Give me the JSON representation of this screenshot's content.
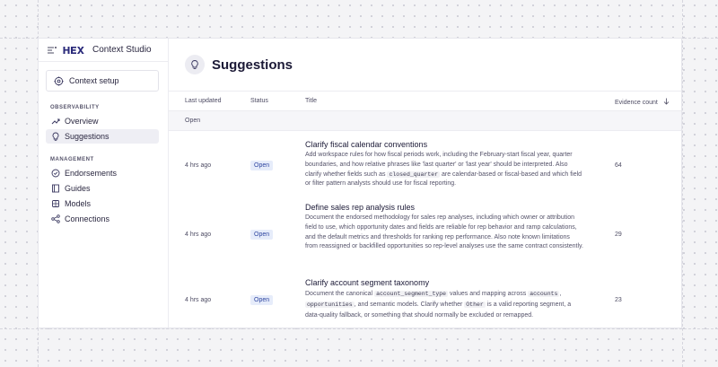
{
  "app": {
    "title": "Context Studio",
    "logo_text": "HEX"
  },
  "sidebar": {
    "context_setup_label": "Context setup",
    "observability_label": "OBSERVABILITY",
    "observability_items": [
      {
        "label": "Overview",
        "icon": "trend-icon"
      },
      {
        "label": "Suggestions",
        "icon": "lightbulb-icon",
        "active": true
      }
    ],
    "management_label": "MANAGEMENT",
    "management_items": [
      {
        "label": "Endorsements",
        "icon": "check-circle-icon"
      },
      {
        "label": "Guides",
        "icon": "book-icon"
      },
      {
        "label": "Models",
        "icon": "cube-icon"
      },
      {
        "label": "Connections",
        "icon": "share-icon"
      }
    ]
  },
  "page": {
    "title": "Suggestions"
  },
  "table": {
    "columns": {
      "last_updated": "Last updated",
      "status": "Status",
      "title": "Title",
      "evidence_count": "Evidence count"
    },
    "group_label": "Open",
    "rows": [
      {
        "updated": "4 hrs ago",
        "status": "Open",
        "title": "Clarify fiscal calendar conventions",
        "evidence": "64",
        "desc_1": "Add workspace rules for how fiscal periods work, including the February-start fiscal year, quarter boundaries, and how relative phrases like 'last quarter' or 'last year' should be interpreted. Also clarify whether fields such as",
        "code_1": "closed_quarter",
        "desc_2": "are calendar-based or fiscal-based and which field or filter pattern analysts should use for fiscal reporting."
      },
      {
        "updated": "4 hrs ago",
        "status": "Open",
        "title": "Define sales rep analysis rules",
        "evidence": "29",
        "desc_1": "Document the endorsed methodology for sales rep analyses, including which owner or attribution field to use, which opportunity dates and fields are reliable for rep behavior and ramp calculations, and the default metrics and thresholds for ranking rep performance. Also note known limitations from reassigned or backfilled opportunities so rep-level analyses use the same contract consistently."
      },
      {
        "updated": "4 hrs ago",
        "status": "Open",
        "title": "Clarify account segment taxonomy",
        "evidence": "23",
        "desc_1": "Document the canonical",
        "code_1": "account_segment_type",
        "desc_2": "values and mapping across",
        "code_2": "accounts",
        "desc_3": ",",
        "code_3": "opportunities",
        "desc_4": ", and semantic models. Clarify whether",
        "code_4": "Other",
        "desc_5": "is a valid reporting segment, a data-quality fallback, or something that should normally be excluded or remapped."
      }
    ]
  }
}
